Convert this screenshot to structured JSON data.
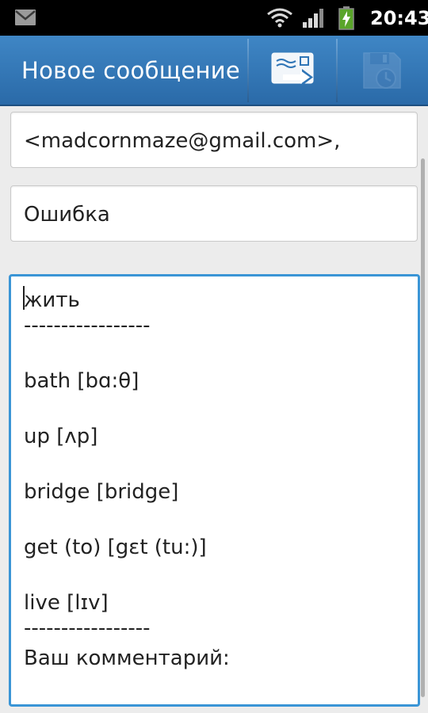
{
  "status_bar": {
    "time": "20:43",
    "icons": [
      "gmail-notification-icon",
      "wifi-icon",
      "signal-icon",
      "battery-charging-icon"
    ]
  },
  "action_bar": {
    "title": "Новое сообщение",
    "background_color": "#2f75b6",
    "actions": [
      {
        "name": "send-button",
        "icon": "send-icon"
      },
      {
        "name": "save-draft-button",
        "icon": "save-draft-icon",
        "enabled": false
      }
    ]
  },
  "compose": {
    "to": "<madcornmaze@gmail.com>,",
    "subject": "Ошибка",
    "body_lines": [
      "жить",
      "-----------------",
      "",
      "bath   [bɑ:θ]",
      "",
      "up   [ʌp]",
      "",
      "bridge   [bridge]",
      "",
      "get (to)   [gɛt (tu:)]",
      "",
      "live   [lɪv]",
      "-----------------",
      "Ваш комментарий:"
    ]
  },
  "colors": {
    "focus_border": "#3a95d6",
    "page_background": "#ececec"
  }
}
